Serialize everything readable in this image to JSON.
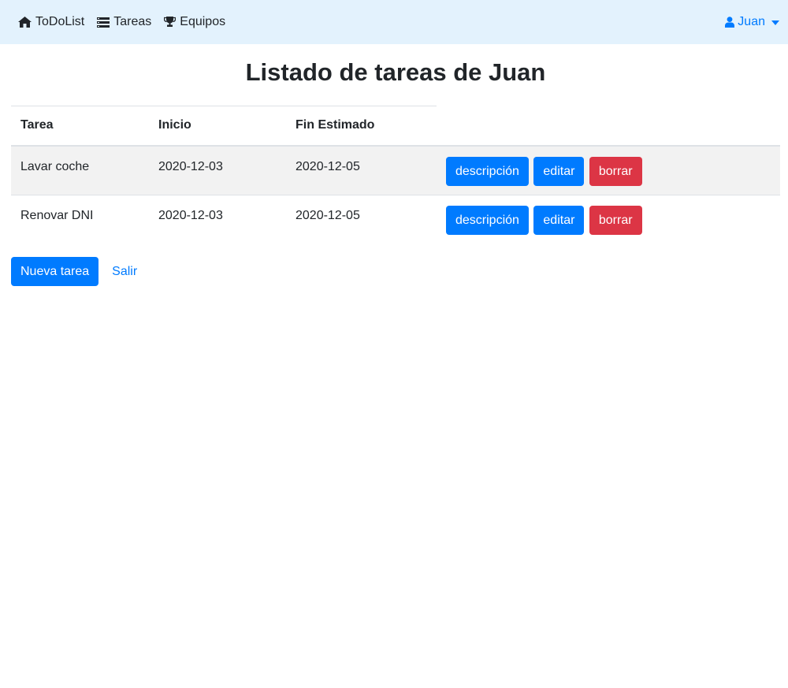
{
  "navbar": {
    "brand": {
      "label": "ToDoList",
      "icon": "home-icon"
    },
    "tasks": {
      "label": "Tareas",
      "icon": "list-icon"
    },
    "teams": {
      "label": "Equipos",
      "icon": "trophy-icon"
    },
    "user": {
      "label": "Juan",
      "icon": "user-icon"
    }
  },
  "page": {
    "title": "Listado de tareas de Juan"
  },
  "table": {
    "headers": [
      "Tarea",
      "Inicio",
      "Fin Estimado",
      ""
    ],
    "rows": [
      {
        "task": "Lavar coche",
        "start": "2020-12-03",
        "end": "2020-12-05"
      },
      {
        "task": "Renovar DNI",
        "start": "2020-12-03",
        "end": "2020-12-05"
      }
    ],
    "actions": {
      "description": "descripción",
      "edit": "editar",
      "delete": "borrar"
    }
  },
  "footer": {
    "new_task": "Nueva tarea",
    "exit": "Salir"
  },
  "colors": {
    "navbar_bg": "#e3f2fd",
    "primary": "#007bff",
    "danger": "#dc3545",
    "stripe": "#f2f2f2"
  }
}
